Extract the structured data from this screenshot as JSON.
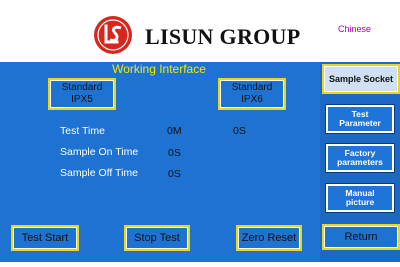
{
  "header": {
    "brand": "LISUN GROUP",
    "language_link": "Chinese",
    "logo_icon": "lisun-logo-icon"
  },
  "main": {
    "title": "Working Interface",
    "standard_left": {
      "line1": "Standard",
      "line2": "IPX5"
    },
    "standard_right": {
      "line1": "Standard",
      "line2": "IPX6"
    },
    "rows": [
      {
        "label": "Test Time",
        "value1": "0M",
        "value2": "0S"
      },
      {
        "label": "Sample On Time",
        "value1": "0S"
      },
      {
        "label": "Sample Off Time",
        "value1": "0S"
      }
    ],
    "buttons": {
      "test_start": "Test Start",
      "stop_test": "Stop Test",
      "zero_reset": "Zero Reset"
    }
  },
  "sidebar": {
    "sample_socket": "Sample Socket",
    "test_parameter": {
      "line1": "Test",
      "line2": "Parameter"
    },
    "factory_parameters": {
      "line1": "Factory",
      "line2": "parameters"
    },
    "manual_picture": {
      "line1": "Manual",
      "line2": "picture"
    },
    "return": "Return"
  },
  "colors": {
    "panel_blue": "#1e73d2",
    "title_yellow": "#f5e800",
    "button_border": "#e6d81c",
    "logo_red": "#d7261d",
    "language_magenta": "#b000b0"
  }
}
